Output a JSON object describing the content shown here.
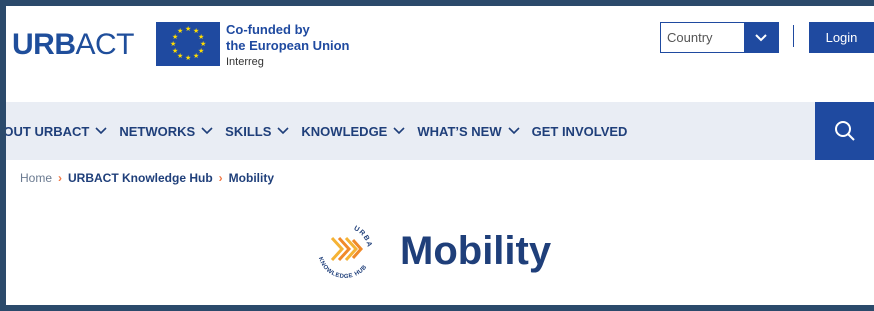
{
  "header": {
    "logo_bold": "URB",
    "logo_thin": "ACT",
    "eu": {
      "line1": "Co-funded by",
      "line2": "the European Union",
      "line3": "Interreg"
    },
    "country_label": "Country",
    "login_label": "Login"
  },
  "nav": {
    "items": [
      {
        "label": "BOUT URBACT",
        "has_dropdown": true
      },
      {
        "label": "NETWORKS",
        "has_dropdown": true
      },
      {
        "label": "SKILLS",
        "has_dropdown": true
      },
      {
        "label": "KNOWLEDGE",
        "has_dropdown": true
      },
      {
        "label": "WHAT’S NEW",
        "has_dropdown": true
      },
      {
        "label": "GET INVOLVED",
        "has_dropdown": false
      }
    ]
  },
  "breadcrumb": {
    "home": "Home",
    "hub": "URBACT Knowledge Hub",
    "current": "Mobility"
  },
  "hub_logo": {
    "top_text": "URBACT",
    "bottom_text": "KNOWLEDGE HUB"
  },
  "page_title": "Mobility",
  "colors": {
    "brand_blue": "#1f4aa0",
    "nav_bg": "#e9edf4",
    "accent_orange": "#f07a48",
    "hub_yellow": "#f5b335"
  }
}
